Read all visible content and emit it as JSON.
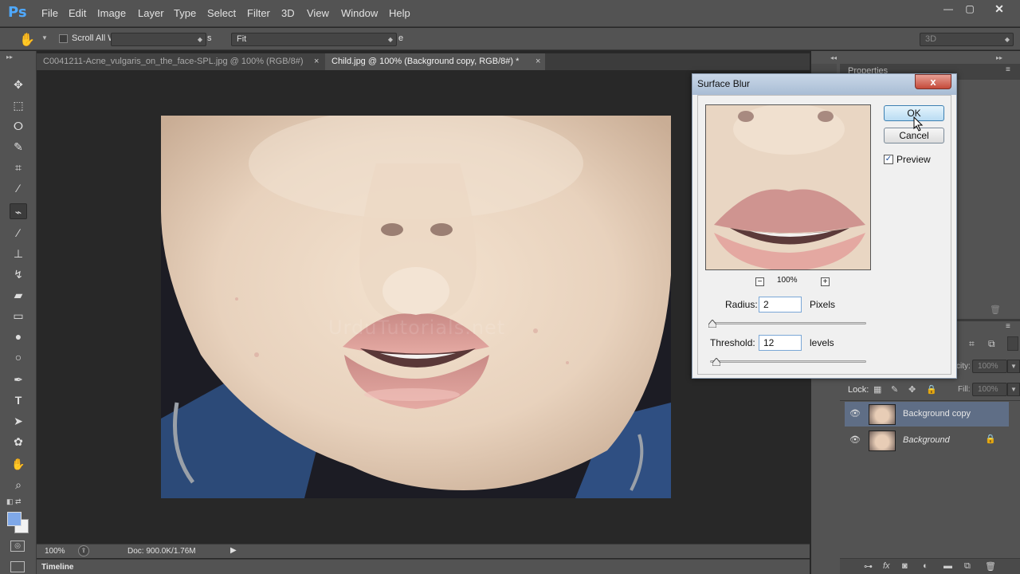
{
  "app": {
    "logo": "Ps"
  },
  "menu": [
    "File",
    "Edit",
    "Image",
    "Layer",
    "Type",
    "Select",
    "Filter",
    "3D",
    "View",
    "Window",
    "Help"
  ],
  "options_bar": {
    "scroll_all_label": "Scroll All W",
    "fit_label": "Fit",
    "mode_label": "3D",
    "hidden_suffix_1": "s",
    "hidden_suffix_2": "e"
  },
  "tabs": [
    {
      "label": "C0041211-Acne_vulgaris_on_the_face-SPL.jpg @ 100% (RGB/8#)",
      "close": "×"
    },
    {
      "label": "Child.jpg @ 100% (Background copy, RGB/8#) *",
      "close": "×"
    }
  ],
  "watermark": "UrduTutorials.net",
  "status": {
    "zoom": "100%",
    "doc_info": "Doc: 900.0K/1.76M"
  },
  "timeline": {
    "label": "Timeline"
  },
  "panels": {
    "properties_label": "Properties",
    "opacity_label": "city:",
    "opacity_value": "100%",
    "lock_label": "Lock:",
    "fill_label": "Fill:",
    "fill_value": "100%"
  },
  "layers": [
    {
      "name": "Background copy",
      "selected": true
    },
    {
      "name": "Background",
      "locked": true
    }
  ],
  "dialog": {
    "title": "Surface Blur",
    "close": "x",
    "ok_label": "OK",
    "cancel_label": "Cancel",
    "preview_label": "Preview",
    "preview_checked": true,
    "zoom_value": "100%",
    "radius_label": "Radius:",
    "radius_value": "2",
    "radius_unit": "Pixels",
    "threshold_label": "Threshold:",
    "threshold_value": "12",
    "threshold_unit": "levels"
  },
  "colors": {
    "accent": "#4fa9ff",
    "selection": "#5f6e86",
    "dialog_bg": "#f0f0f0"
  }
}
